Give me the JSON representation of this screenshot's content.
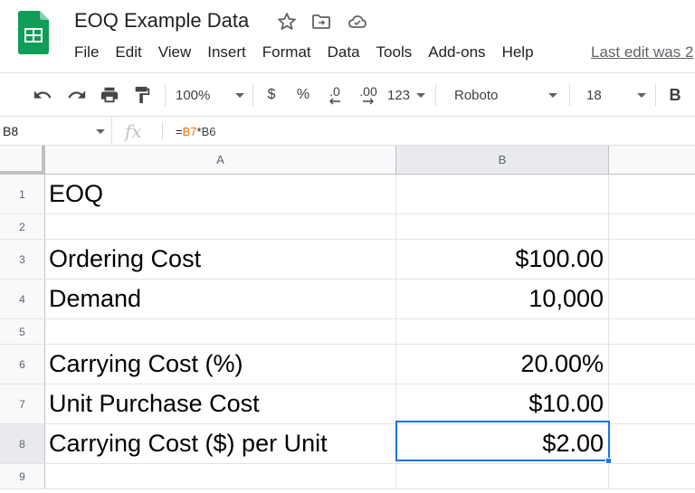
{
  "app": {
    "title": "EOQ Example Data",
    "menu": [
      "File",
      "Edit",
      "View",
      "Insert",
      "Format",
      "Data",
      "Tools",
      "Add-ons",
      "Help"
    ],
    "last_edit": "Last edit was 2"
  },
  "toolbar": {
    "zoom": "100%",
    "currency": "$",
    "percent": "%",
    "decrease_decimal": ".0",
    "increase_decimal": ".00",
    "more_formats": "123",
    "font": "Roboto",
    "font_size": "18",
    "bold": "B"
  },
  "formula_bar": {
    "name_box": "B8",
    "fx": "fx",
    "formula_eq": "=",
    "formula_ref1": "B7",
    "formula_op": "*",
    "formula_ref2": "B6"
  },
  "grid": {
    "columns": [
      "A",
      "B"
    ],
    "rows": [
      {
        "num": "1",
        "a": "EOQ",
        "b": ""
      },
      {
        "num": "2",
        "a": "",
        "b": ""
      },
      {
        "num": "3",
        "a": "Ordering Cost",
        "b": "$100.00"
      },
      {
        "num": "4",
        "a": "Demand",
        "b": "10,000"
      },
      {
        "num": "5",
        "a": "",
        "b": ""
      },
      {
        "num": "6",
        "a": "Carrying Cost (%)",
        "b": "20.00%"
      },
      {
        "num": "7",
        "a": "Unit Purchase Cost",
        "b": "$10.00"
      },
      {
        "num": "8",
        "a": "Carrying Cost ($) per Unit",
        "b": "$2.00"
      },
      {
        "num": "9",
        "a": "",
        "b": ""
      }
    ]
  },
  "colors": {
    "selection": "#1a73e8",
    "logo_green": "#0f9d58",
    "ref_orange": "#e8710a"
  }
}
